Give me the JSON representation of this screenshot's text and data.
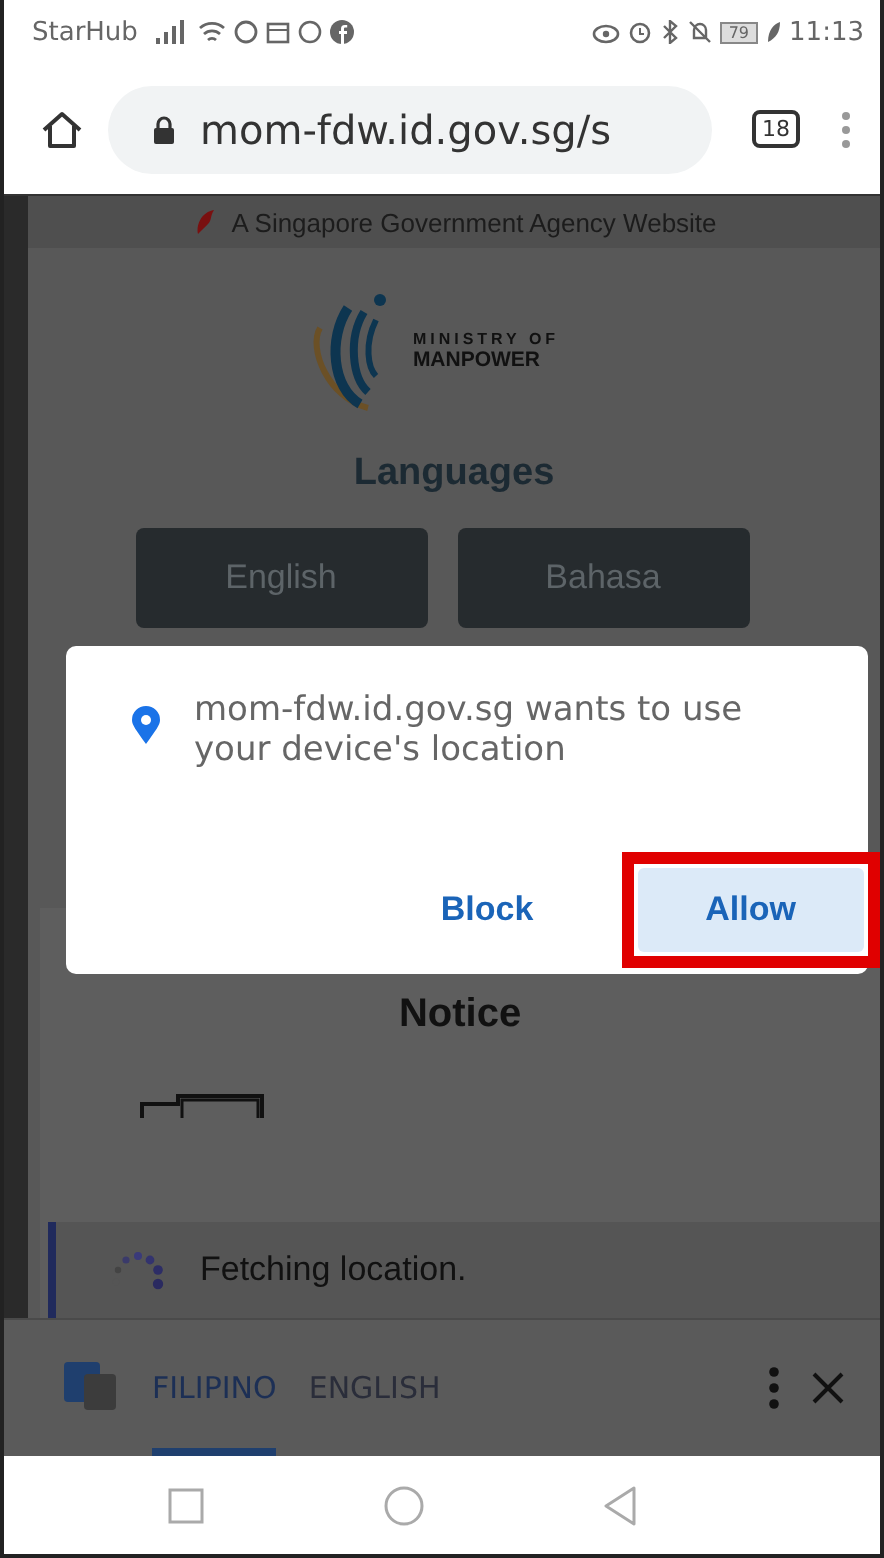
{
  "status_bar": {
    "carrier": "StarHub",
    "battery": "79",
    "time": "11:13"
  },
  "browser": {
    "url": "mom-fdw.id.gov.sg/s",
    "tab_count": "18"
  },
  "page": {
    "agency_banner": "A Singapore Government Agency Website",
    "logo_text": [
      "MINISTRY OF",
      "MANPOWER"
    ],
    "languages_heading": "Languages",
    "language_buttons": [
      "English",
      "Bahasa"
    ],
    "notice_heading": "Notice"
  },
  "dialog": {
    "message": "mom-fdw.id.gov.sg wants to use your device's location",
    "buttons": [
      {
        "label": "Block",
        "kind": "text",
        "highlighted": false
      },
      {
        "label": "Allow",
        "kind": "tonal",
        "highlighted": true
      }
    ]
  },
  "snackbar": {
    "message": "Fetching location."
  },
  "translate_bar": {
    "languages": [
      {
        "label": "FILIPINO",
        "selected": true
      },
      {
        "label": "ENGLISH",
        "selected": false
      }
    ]
  }
}
